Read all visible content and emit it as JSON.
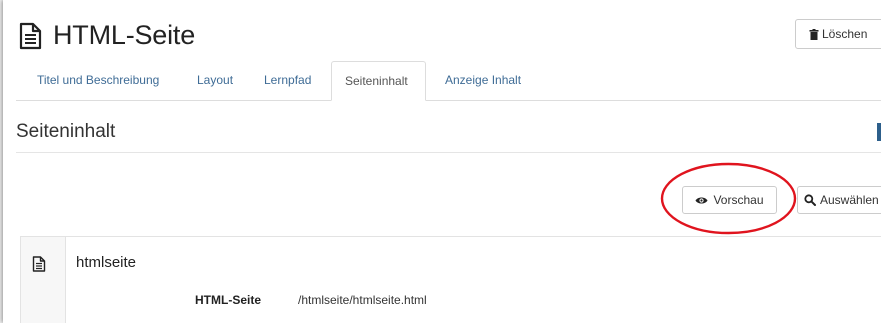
{
  "header": {
    "title": "HTML-Seite",
    "delete_label": "Löschen"
  },
  "tabs": [
    {
      "label": "Titel und Beschreibung",
      "active": false
    },
    {
      "label": "Layout",
      "active": false
    },
    {
      "label": "Lernpfad",
      "active": false
    },
    {
      "label": "Seiteninhalt",
      "active": true
    },
    {
      "label": "Anzeige Inhalt",
      "active": false
    }
  ],
  "section": {
    "title": "Seiteninhalt",
    "preview_label": "Vorschau",
    "select_label": "Auswählen"
  },
  "item": {
    "title": "htmlseite",
    "detail_label": "HTML-Seite",
    "detail_value": "/htmlseite/htmlseite.html"
  },
  "colors": {
    "link": "#3f6c96",
    "highlight": "#e0141e"
  }
}
